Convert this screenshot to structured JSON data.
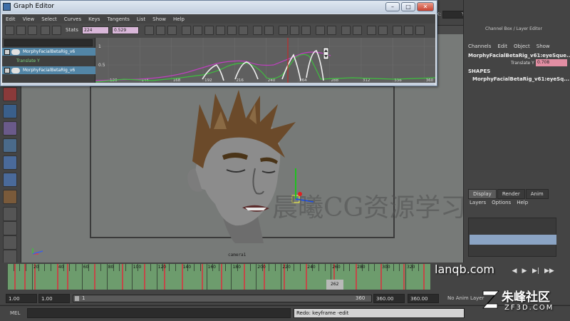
{
  "graph_editor": {
    "title": "Graph Editor",
    "window_buttons": {
      "minimize": "–",
      "maximize": "□",
      "close": "✕"
    },
    "menus": [
      "Edit",
      "View",
      "Select",
      "Curves",
      "Keys",
      "Tangents",
      "List",
      "Show",
      "Help"
    ],
    "stats_label": "Stats",
    "stats_frame": "224",
    "stats_value": "0.529",
    "outliner": {
      "rows": [
        {
          "label": "MorphyFacialBetaRig_v6",
          "selected": true
        },
        {
          "label": "Translate Y",
          "kind": "attribute"
        },
        {
          "label": "MorphyFacialBetaRig_v6",
          "selected": true
        }
      ]
    },
    "graph": {
      "y_labels": [
        "1",
        "0.5"
      ],
      "x_labels": [
        "120",
        "144",
        "168",
        "192",
        "216",
        "240",
        "264",
        "288",
        "312",
        "336",
        "360"
      ],
      "curve_colors": {
        "green": "#3ec03e",
        "magenta": "#c040c0",
        "white": "#f0f0f0",
        "current_time": "#d02020"
      }
    }
  },
  "maya_toolbar": {
    "coord_labels": [
      "X:",
      "Y:",
      "Z:"
    ]
  },
  "channel_box": {
    "title": "Channel Box / Layer Editor",
    "menus": [
      "Channels",
      "Edit",
      "Object",
      "Show"
    ],
    "object_name": "MorphyFacialBetaRig_v61:eyeSque...",
    "attribute_label": "Translate Y",
    "attribute_value": "0.708",
    "shapes_header": "SHAPES",
    "shape_name": "MorphyFacialBetaRig_v61:eyeSq..."
  },
  "layer_editor": {
    "tabs": [
      "Display",
      "Render",
      "Anim"
    ],
    "menus": [
      "Layers",
      "Options",
      "Help"
    ]
  },
  "viewport": {
    "camera_label": "camera1",
    "watermark": "晨曦CG资源学习店"
  },
  "timeslider": {
    "tick_labels": [
      "20",
      "40",
      "60",
      "80",
      "100",
      "120",
      "140",
      "160",
      "180",
      "200",
      "220",
      "240",
      "260",
      "280",
      "300",
      "320",
      "340"
    ],
    "current_frame": "262",
    "watermark": "lanqb.com"
  },
  "range": {
    "start": "1.00",
    "playback_start": "1.00",
    "slider_start": "1",
    "slider_end": "360",
    "playback_end": "360.00",
    "end": "360.00",
    "anim_layer": "No Anim Layer"
  },
  "command_line": {
    "label": "MEL",
    "result": "Redo: keyframe -edit"
  },
  "site_watermark": {
    "name": "朱峰社区",
    "domain": "ZF3D.COM"
  }
}
